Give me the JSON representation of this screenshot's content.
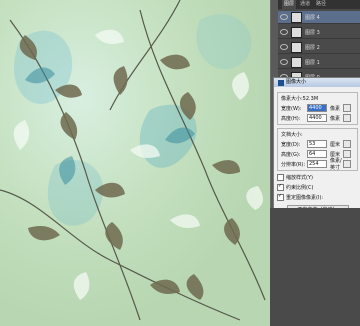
{
  "canvas": {
    "alt": "watercolor leaf pattern"
  },
  "layers_panel": {
    "tabs": [
      "图层",
      "通道",
      "路径"
    ],
    "rows": [
      {
        "name": "图层 4",
        "num": ""
      },
      {
        "name": "图层 3",
        "num": ""
      },
      {
        "name": "图层 2",
        "num": ""
      },
      {
        "name": "图层 1",
        "num": ""
      },
      {
        "name": "图层 0",
        "num": ""
      }
    ]
  },
  "dialog": {
    "title": "图像大小",
    "pixel_size_label": "像素大小:52.3M",
    "width_label": "宽度(W):",
    "width_value": "4400",
    "width_unit": "像素",
    "height_label": "高度(H):",
    "height_value": "4400",
    "height_unit": "像素",
    "doc_size_label": "文档大小:",
    "doc_width_label": "宽度(D):",
    "doc_width_value": "53",
    "doc_width_unit": "厘米",
    "doc_height_label": "高度(G):",
    "doc_height_value": "64",
    "doc_height_unit": "厘米",
    "res_label": "分辨率(R):",
    "res_value": "254",
    "res_unit": "像素/英寸",
    "scale_styles": "缩放样式(Y)",
    "constrain": "约束比例(C)",
    "resample": "重定图像像素(I):",
    "resample_method": "两次立方（自动）"
  }
}
